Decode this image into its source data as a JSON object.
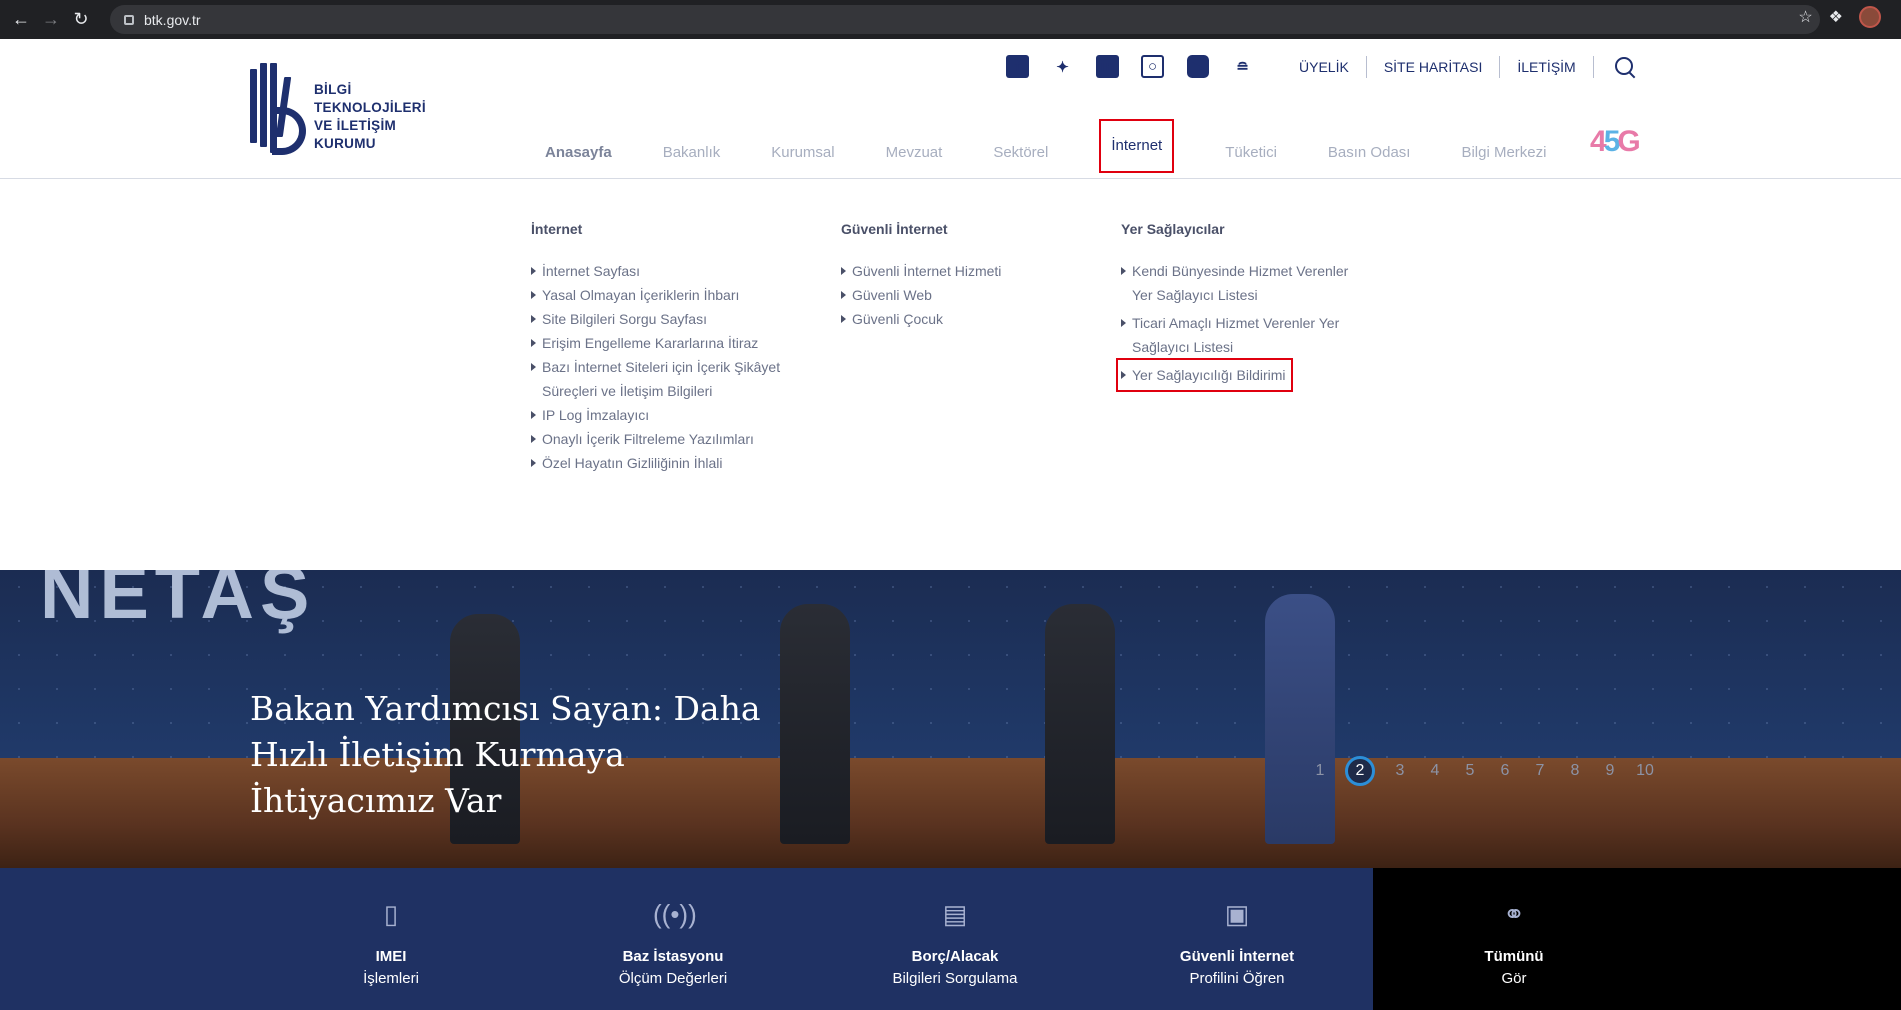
{
  "browser": {
    "url": "btk.gov.tr"
  },
  "logo": {
    "lines": [
      "BİLGİ",
      "TEKNOLOJİLERİ",
      "VE İLETİŞİM",
      "KURUMU"
    ]
  },
  "social_icons": [
    "facebook-icon",
    "twitter-icon",
    "linkedin-icon",
    "instagram-icon",
    "youtube-icon",
    "rss-icon"
  ],
  "utility_links": [
    "ÜYELİK",
    "SİTE HARİTASI",
    "İLETİŞİM"
  ],
  "main_nav": [
    "Anasayfa",
    "Bakanlık",
    "Kurumsal",
    "Mevzuat",
    "Sektörel",
    "İnternet",
    "Tüketici",
    "Basın Odası",
    "Bilgi Merkezi"
  ],
  "logo_45g": {
    "four": "4",
    "five": "5",
    "g": "G"
  },
  "dropdown": {
    "internet": {
      "title": "İnternet",
      "items": [
        "İnternet Sayfası",
        "Yasal Olmayan İçeriklerin İhbarı",
        "Site Bilgileri Sorgu Sayfası",
        "Erişim Engelleme Kararlarına İtiraz",
        "Bazı İnternet Siteleri için İçerik Şikâyet Süreçleri ve İletişim Bilgileri",
        "IP Log İmzalayıcı",
        "Onaylı İçerik Filtreleme Yazılımları",
        "Özel Hayatın Gizliliğinin İhlali"
      ]
    },
    "guvenli": {
      "title": "Güvenli İnternet",
      "items": [
        "Güvenli İnternet Hizmeti",
        "Güvenli Web",
        "Güvenli Çocuk"
      ]
    },
    "yer": {
      "title": "Yer Sağlayıcılar",
      "items": [
        "Kendi Bünyesinde Hizmet Verenler Yer Sağlayıcı Listesi",
        "Ticari Amaçlı Hizmet Verenler Yer Sağlayıcı Listesi",
        "Yer Sağlayıcılığı Bildirimi"
      ]
    }
  },
  "hero": {
    "title": "Bakan Yardımcısı Sayan: Daha Hızlı İletişim Kurmaya İhtiyacımız Var",
    "wall_brand": "NETAŞ",
    "pages": [
      "1",
      "2",
      "3",
      "4",
      "5",
      "6",
      "7",
      "8",
      "9",
      "10"
    ],
    "current_page": "2"
  },
  "services": [
    {
      "title": "IMEI",
      "subtitle": "İşlemleri",
      "icon": "phone-icon"
    },
    {
      "title": "Baz İstasyonu",
      "subtitle": "Ölçüm Değerleri",
      "icon": "antenna-icon"
    },
    {
      "title": "Borç/Alacak",
      "subtitle": "Bilgileri Sorgulama",
      "icon": "chart-icon"
    },
    {
      "title": "Güvenli İnternet",
      "subtitle": "Profilini Öğren",
      "icon": "lock-icon"
    },
    {
      "title": "Tümünü",
      "subtitle": "Gör",
      "icon": "link-icon"
    }
  ]
}
